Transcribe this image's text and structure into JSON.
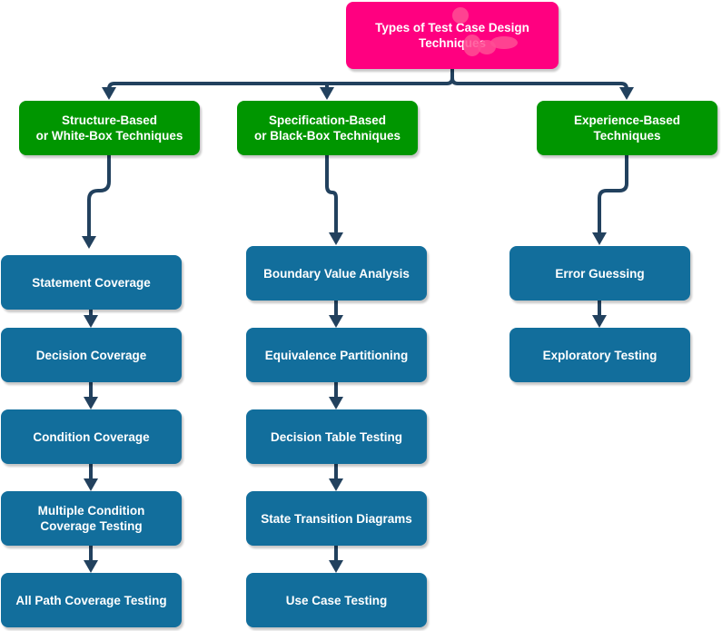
{
  "root": {
    "label": "Types of Test Case Design\nTechniques",
    "color": "#ff0080"
  },
  "colors": {
    "category": "#009600",
    "technique": "#126e9c",
    "connector": "#22415e"
  },
  "categories": [
    {
      "label": "Structure-Based\nor White-Box Techniques",
      "techniques": [
        "Statement Coverage",
        "Decision Coverage",
        "Condition Coverage",
        "Multiple Condition\nCoverage Testing",
        "All Path Coverage Testing"
      ]
    },
    {
      "label": "Specification-Based\nor Black-Box Techniques",
      "techniques": [
        "Boundary Value Analysis",
        "Equivalence Partitioning",
        "Decision Table Testing",
        "State Transition Diagrams",
        "Use Case Testing"
      ]
    },
    {
      "label": "Experience-Based\nTechniques",
      "techniques": [
        "Error Guessing",
        "Exploratory Testing"
      ]
    }
  ]
}
